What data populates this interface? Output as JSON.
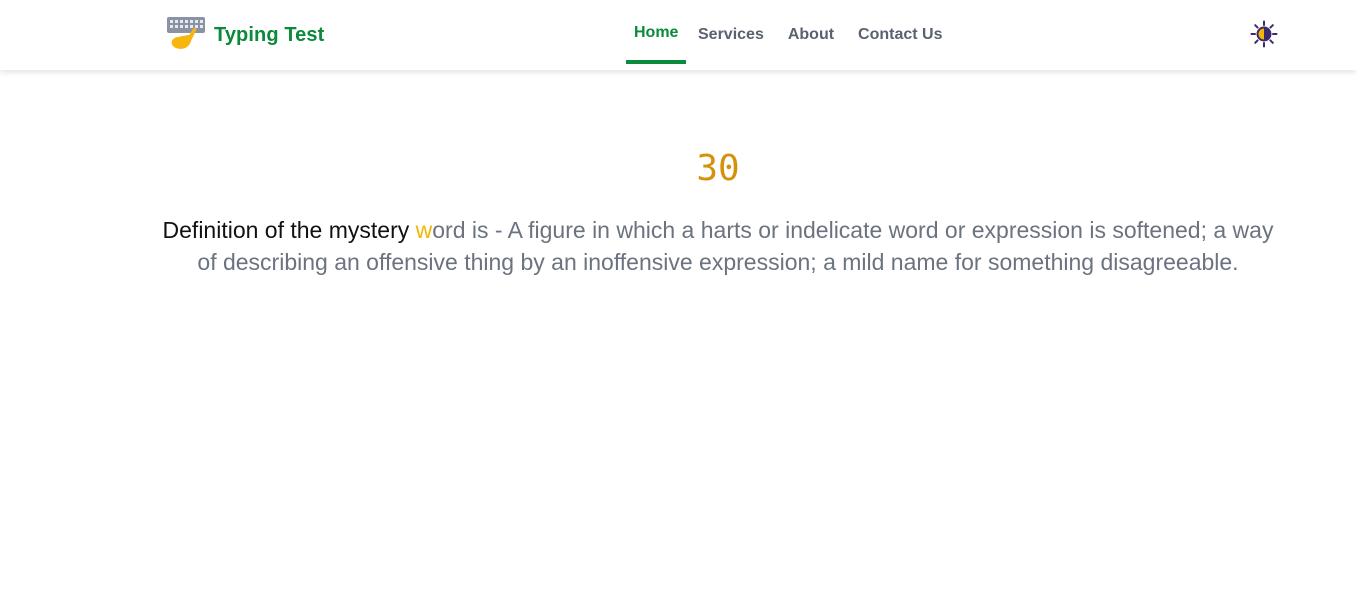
{
  "header": {
    "brand": "Typing Test",
    "logo_icon": "keyboard-hand-icon",
    "nav": [
      {
        "label": "Home",
        "active": true
      },
      {
        "label": "Services",
        "active": false
      },
      {
        "label": "About",
        "active": false
      },
      {
        "label": "Contact Us",
        "active": false
      }
    ],
    "theme_icon": "sun-icon"
  },
  "test": {
    "timer": "30",
    "typed_text": "Definition of the mystery ",
    "current_char": "w",
    "remaining_text": "ord is - A figure in which a harts or indelicate word or expression is softened; a way of describing an offensive thing by an inoffensive expression; a mild name for something disagreeable."
  },
  "colors": {
    "brand": "#0a8a3a",
    "timer": "#d4920a",
    "current_char": "#f2b705",
    "typed": "#111111",
    "remaining": "#6b7280"
  }
}
